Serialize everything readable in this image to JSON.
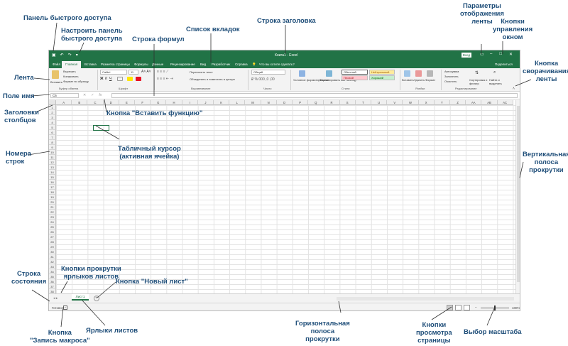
{
  "annotations": {
    "qat": "Панель быстрого доступа",
    "customize_qat": [
      "Настроить панель",
      "быстрого доступа"
    ],
    "formula_bar": "Строка формул",
    "tab_list": "Список вкладок",
    "title_bar": "Строка заголовка",
    "ribbon_display": [
      "Параметры",
      "отображения",
      "ленты"
    ],
    "window_controls": [
      "Кнопки",
      "управления",
      "окном"
    ],
    "ribbon": "Лента",
    "collapse_ribbon": [
      "Кнопка",
      "сворачивания",
      "ленты"
    ],
    "name_box": "Поле имя",
    "column_headers": [
      "Заголовки",
      "столбцов"
    ],
    "insert_function": "Кнопка \"Вставить функцию\"",
    "row_numbers": [
      "Номера",
      "строк"
    ],
    "table_cursor": [
      "Табличный курсор",
      "(активная ячейка)"
    ],
    "vertical_scroll": [
      "Вертикальная",
      "полоса",
      "прокрутки"
    ],
    "sheet_scroll_buttons": [
      "Кнопки прокрутки",
      "ярлыков листов"
    ],
    "status_bar": [
      "Строка",
      "состояния"
    ],
    "new_sheet": "Кнопка \"Новый лист\"",
    "record_macro": [
      "Кнопка",
      "\"Запись макроса\""
    ],
    "sheet_tabs": "Ярлыки листов",
    "horizontal_scroll": [
      "Горизонтальная",
      "полоса",
      "прокрутки"
    ],
    "page_view_buttons": [
      "Кнопки",
      "просмотра",
      "страницы"
    ],
    "zoom": "Выбор масштаба"
  },
  "window": {
    "title": "Книга1 - Excel",
    "signin": "Вход",
    "share": "Поделиться"
  },
  "tabs": [
    "Файл",
    "Главная",
    "Вставка",
    "Разметка страницы",
    "Формулы",
    "Данные",
    "Рецензирование",
    "Вид",
    "Разработчик",
    "Справка"
  ],
  "tell_me": "Что вы хотите сделать?",
  "ribbon": {
    "paste": "Вставить",
    "cut": "Вырезать",
    "copy": "Копировать",
    "format_painter": "Формат по образцу",
    "font_name": "Calibri",
    "font_size": "11",
    "wrap_text": "Переносить текст",
    "merge_center": "Объединить и поместить в центре",
    "number_format": "Общий",
    "conditional_formatting": "Условное форматирование",
    "format_as_table": "Форматировать как таблицу",
    "style_normal": "Обычный",
    "style_neutral": "Нейтральный",
    "style_bad": "Плохой",
    "style_good": "Хороший",
    "insert": "Вставить",
    "delete": "Удалить",
    "format": "Формат",
    "autosum": "Автосумма",
    "fill": "Заполнить",
    "clear": "Очистить",
    "sort_filter": "Сортировка и фильтр",
    "find_select": "Найти и выделить",
    "groups": {
      "clipboard": "Буфер обмена",
      "font": "Шрифт",
      "alignment": "Выравнивание",
      "number": "Число",
      "styles": "Стили",
      "cells": "Ячейки",
      "editing": "Редактирование"
    }
  },
  "formula": {
    "name_box": "C6"
  },
  "columns": [
    "A",
    "B",
    "C",
    "D",
    "E",
    "F",
    "G",
    "H",
    "I",
    "J",
    "K",
    "L",
    "M",
    "N",
    "O",
    "P",
    "Q",
    "R",
    "S",
    "T",
    "U",
    "V",
    "W",
    "X",
    "Y",
    "Z",
    "AA",
    "AB",
    "AC"
  ],
  "sheet": {
    "name": "Лист1"
  },
  "status": {
    "ready": "Готово",
    "zoom": "100%"
  },
  "colors": {
    "excel_green": "#217346",
    "annotation_blue": "#1f4e79"
  }
}
